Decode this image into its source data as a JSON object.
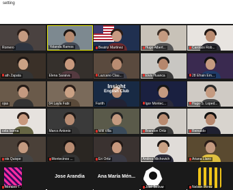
{
  "window": {
    "title": "setting"
  },
  "tiles": [
    {
      "name": "Romero",
      "bg": "#4a4240",
      "skin": "#c49a80",
      "hair": "#2a1d18",
      "shirt": "#2f3540",
      "muted": false
    },
    {
      "name": "Yolanda Ramos",
      "bg": "#7d8990",
      "skin": "#b58a70",
      "hair": "#1a1412",
      "shirt": "#444a55",
      "muted": false,
      "active": true
    },
    {
      "name": "Beatriz Martinez",
      "bg": "#203050",
      "skin": "#c89a82",
      "hair": "#2a1c16",
      "shirt": "#6b2a30",
      "muted": true,
      "flag": true
    },
    {
      "name": "Hugo Albert...",
      "bg": "#c8c2b8",
      "skin": "#c49a80",
      "hair": "#3a2d25",
      "shirt": "#555",
      "muted": true
    },
    {
      "name": "Cardozo Rob...",
      "bg": "#e8e4e0",
      "skin": "#b98b70",
      "hair": "#1d1512",
      "shirt": "#2d2d35",
      "muted": true
    },
    {
      "name": "ath Zapata",
      "bg": "#3a3028",
      "skin": "#caa184",
      "hair": "#1f1815",
      "shirt": "#333",
      "muted": true
    },
    {
      "name": "Elena Saraiva",
      "bg": "#35302c",
      "skin": "#c8997e",
      "hair": "#201714",
      "shirt": "#553a40",
      "muted": false
    },
    {
      "name": "Lazcano Clau...",
      "bg": "#5a4a3e",
      "skin": "#b88c72",
      "hair": "#2c211b",
      "shirt": "#40404a",
      "muted": true
    },
    {
      "name": "Elvis Huanca",
      "bg": "#c8c6c2",
      "skin": "#b6876d",
      "hair": "#1a1a1a",
      "shirt": "#3a3a3a",
      "muted": true
    },
    {
      "name": "28 Efrain Em...",
      "bg": "#3a2a50",
      "skin": "#c49a80",
      "hair": "#111",
      "shirt": "#1f3c6a",
      "muted": true
    },
    {
      "name": "ojas",
      "bg": "#6a5a4a",
      "skin": "#c49a80",
      "hair": "#241b16",
      "shirt": "#333",
      "muted": false
    },
    {
      "name": "04 Layla Fabi",
      "bg": "#7a6a5a",
      "skin": "#caa184",
      "hair": "#2a1d18",
      "shirt": "#5a4a3a",
      "muted": false
    },
    {
      "name": "Farith",
      "bg": "#182a44",
      "skin": "#b88c72",
      "hair": "#111",
      "shirt": "#223",
      "muted": false,
      "banner": "Insight\nEnglish Club"
    },
    {
      "name": "Igor Montec...",
      "bg": "#1a2040",
      "skin": "#c49a80",
      "hair": "#161616",
      "shirt": "#2a2a3a",
      "muted": true
    },
    {
      "name": "Hugo S. Loped...",
      "bg": "#cfcac4",
      "skin": "#c49a80",
      "hair": "#2a2a2a",
      "shirt": "#444",
      "muted": true
    },
    {
      "name": "cela Isorna",
      "bg": "#e6e2de",
      "skin": "#c8997e",
      "hair": "#2a1d18",
      "shirt": "#664",
      "muted": false
    },
    {
      "name": "Marco Antonio",
      "bg": "#3a3a3a",
      "skin": "#b88c72",
      "hair": "#1f1a18",
      "shirt": "#333",
      "muted": false
    },
    {
      "name": "Will Villa",
      "bg": "#5a5a4a",
      "skin": "#c49a80",
      "hair": "#222",
      "shirt": "#3a4a5a",
      "muted": true
    },
    {
      "name": "Brandon Ortiz",
      "bg": "#d0ccc6",
      "skin": "#b98b70",
      "hair": "#1a1a1a",
      "shirt": "#3a3a3a",
      "muted": true
    },
    {
      "name": "Reinaldo",
      "bg": "#d8d4ce",
      "skin": "#b6876d",
      "hair": "#111",
      "shirt": "#1f2030",
      "muted": true
    },
    {
      "name": "ois Quispe",
      "bg": "#4a4038",
      "skin": "#c49a80",
      "hair": "#2a1d18",
      "shirt": "#444",
      "muted": true
    },
    {
      "name": "Montecinos ...",
      "bg": "#2a2622",
      "skin": "#b88c72",
      "hair": "#1a1412",
      "shirt": "#333",
      "muted": true
    },
    {
      "name": "Eri Ortiz",
      "bg": "#3a3230",
      "skin": "#c8997e",
      "hair": "#201714",
      "shirt": "#3a3a44",
      "muted": true
    },
    {
      "name": "Andrea Michovich",
      "bg": "#e0dcd8",
      "skin": "#caa184",
      "hair": "#1d1613",
      "shirt": "#2a2a3a",
      "muted": false
    },
    {
      "name": "Ariana Llano",
      "bg": "#5a4a30",
      "skin": "#c49a80",
      "hair": "#2a1d18",
      "shirt": "#e0c040",
      "muted": true
    },
    {
      "name": "Morales T.",
      "bg": "#1a1a1a",
      "muted": true,
      "logo": "pattern"
    },
    {
      "name": "Jose Arandia",
      "bg": "#1a1a1a",
      "nameOnly": true
    },
    {
      "name": "Ana María Mén...",
      "bg": "#1a1a1a",
      "nameOnly": true
    },
    {
      "name": "José Bolívar",
      "bg": "#1a1a1a",
      "muted": true,
      "logo": "cat"
    },
    {
      "name": "Nelson Pérez",
      "bg": "#1a1a1a",
      "muted": true,
      "logo": "stripes"
    }
  ]
}
